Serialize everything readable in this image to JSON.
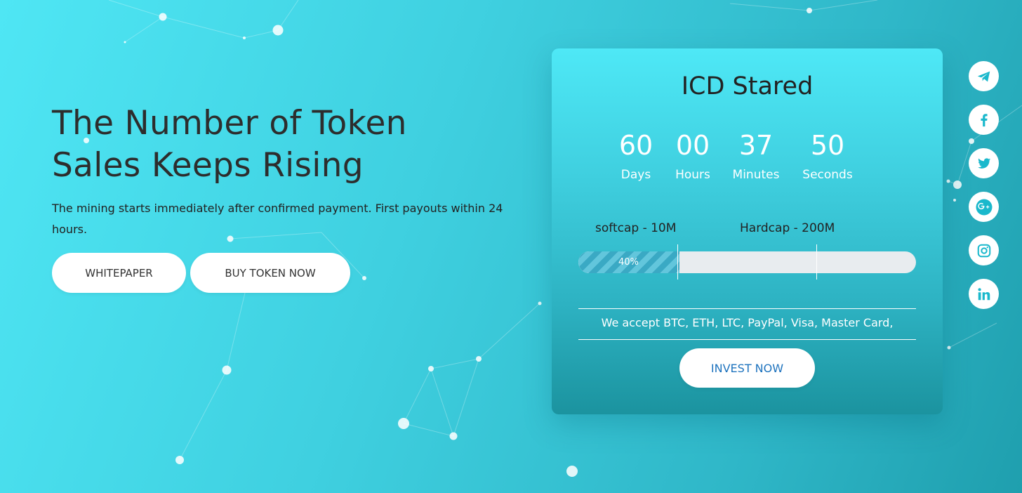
{
  "hero": {
    "title_line1": "The Number of Token",
    "title_line2": "Sales Keeps Rising",
    "description": "The mining starts immediately after confirmed payment. First payouts within 24 hours.",
    "whitepaper_label": "WHITEPAPER",
    "buy_label": "BUY TOKEN NOW"
  },
  "ico": {
    "title": "ICD Stared",
    "countdown": [
      {
        "value": "60",
        "label": "Days"
      },
      {
        "value": "00",
        "label": "Hours"
      },
      {
        "value": "37",
        "label": "Minutes"
      },
      {
        "value": "50",
        "label": "Seconds"
      }
    ],
    "softcap_label": "softcap - 10M",
    "hardcap_label": "Hardcap - 200M",
    "progress_text": "40%",
    "progress_value": 0.3,
    "accept_text": "We accept BTC, ETH, LTC, PayPal, Visa, Master Card,",
    "invest_label": "INVEST NOW"
  },
  "social": [
    "telegram-icon",
    "facebook-icon",
    "twitter-icon",
    "google-plus-icon",
    "instagram-icon",
    "linkedin-icon"
  ],
  "colors": {
    "accent": "#1ab8cc",
    "invest_text": "#1e73be",
    "bg_start": "#4fe6f4",
    "bg_end": "#1f9fae"
  }
}
